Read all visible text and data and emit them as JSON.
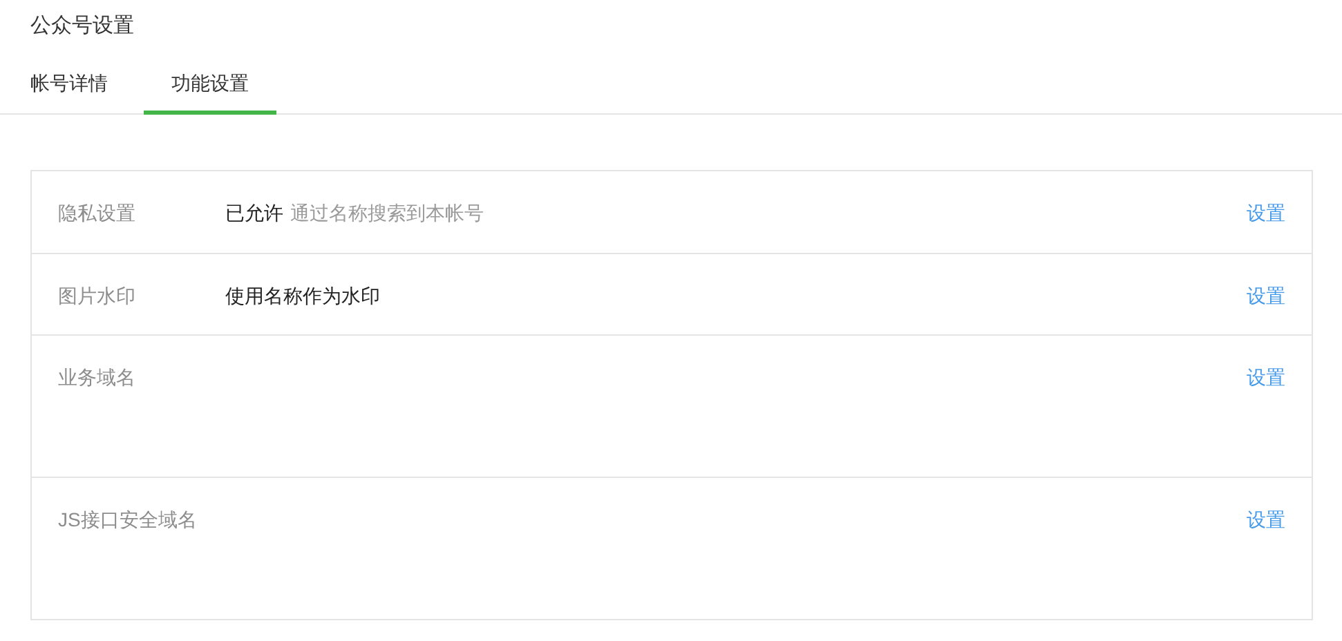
{
  "page_title": "公众号设置",
  "tabs": [
    {
      "label": "帐号详情",
      "selected": false
    },
    {
      "label": "功能设置",
      "selected": true
    }
  ],
  "settings": [
    {
      "label": "隐私设置",
      "value": "已允许",
      "note": "通过名称搜索到本帐号",
      "action": "设置"
    },
    {
      "label": "图片水印",
      "value": "使用名称作为水印",
      "action": "设置"
    },
    {
      "label": "业务域名",
      "kind": "list",
      "action": "设置"
    },
    {
      "label": "JS接口安全域名",
      "kind": "list",
      "action": "设置"
    }
  ]
}
